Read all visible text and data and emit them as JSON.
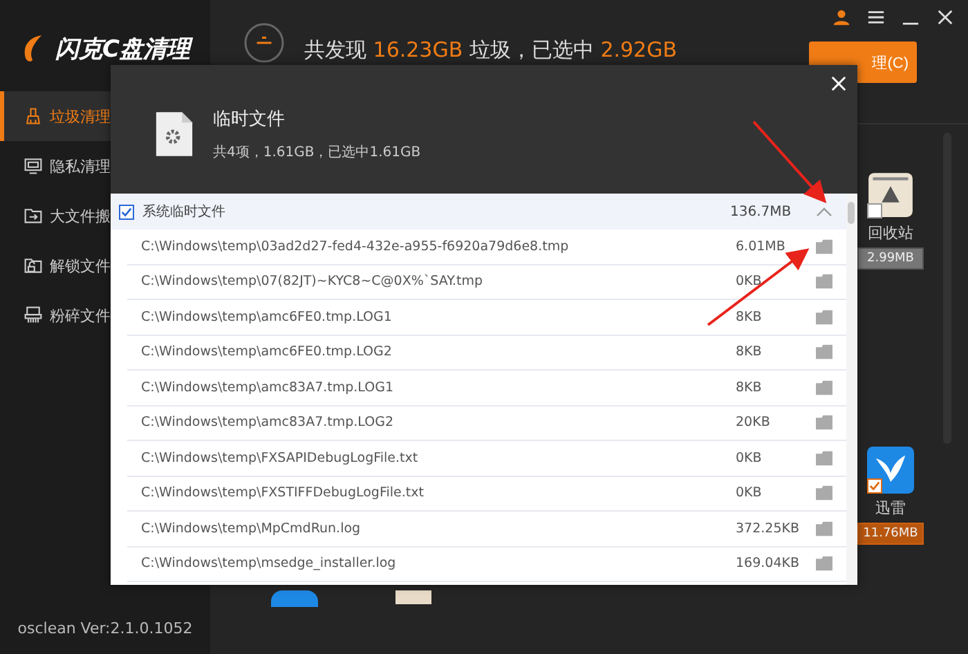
{
  "app": {
    "logo": "闪克C盘清理",
    "version": "osclean Ver:2.1.0.1052"
  },
  "sidebar": {
    "items": [
      {
        "label": "垃圾清理",
        "selected": true,
        "kind": "broom"
      },
      {
        "label": "隐私清理",
        "selected": false,
        "kind": "monitor"
      },
      {
        "label": "大文件搬",
        "selected": false,
        "kind": "move"
      },
      {
        "label": "解锁文件",
        "selected": false,
        "kind": "unlock"
      },
      {
        "label": "粉碎文件",
        "selected": false,
        "kind": "shred"
      }
    ]
  },
  "summary": {
    "segments": [
      {
        "text": "共发现 ",
        "highlight": false
      },
      {
        "text": "16.23GB",
        "highlight": true
      },
      {
        "text": " 垃圾，已选中 ",
        "highlight": false
      },
      {
        "text": "2.92GB",
        "highlight": true
      }
    ]
  },
  "clean_button": {
    "label": "理(C)"
  },
  "tiles": [
    {
      "name": "回收站",
      "size": "2.99MB",
      "checked": false,
      "kind": "recycle"
    },
    {
      "name": "迅雷",
      "size": "11.76MB",
      "checked": true,
      "kind": "bird"
    }
  ],
  "dialog": {
    "title": "临时文件",
    "subtitle": "共4项，1.61GB，已选中1.61GB",
    "group": {
      "label": "系统临时文件",
      "size": "136.7MB",
      "checked": true,
      "expanded": true
    },
    "rows": [
      {
        "path": "C:\\Windows\\temp\\03ad2d27-fed4-432e-a955-f6920a79d6e8.tmp",
        "size": "6.01MB"
      },
      {
        "path": "C:\\Windows\\temp\\07(82JT)~KYC8~C@0X%`SAY.tmp",
        "size": "0KB"
      },
      {
        "path": "C:\\Windows\\temp\\amc6FE0.tmp.LOG1",
        "size": "8KB"
      },
      {
        "path": "C:\\Windows\\temp\\amc6FE0.tmp.LOG2",
        "size": "8KB"
      },
      {
        "path": "C:\\Windows\\temp\\amc83A7.tmp.LOG1",
        "size": "8KB"
      },
      {
        "path": "C:\\Windows\\temp\\amc83A7.tmp.LOG2",
        "size": "20KB"
      },
      {
        "path": "C:\\Windows\\temp\\FXSAPIDebugLogFile.txt",
        "size": "0KB"
      },
      {
        "path": "C:\\Windows\\temp\\FXSTIFFDebugLogFile.txt",
        "size": "0KB"
      },
      {
        "path": "C:\\Windows\\temp\\MpCmdRun.log",
        "size": "372.25KB"
      },
      {
        "path": "C:\\Windows\\temp\\msedge_installer.log",
        "size": "169.04KB"
      }
    ]
  }
}
